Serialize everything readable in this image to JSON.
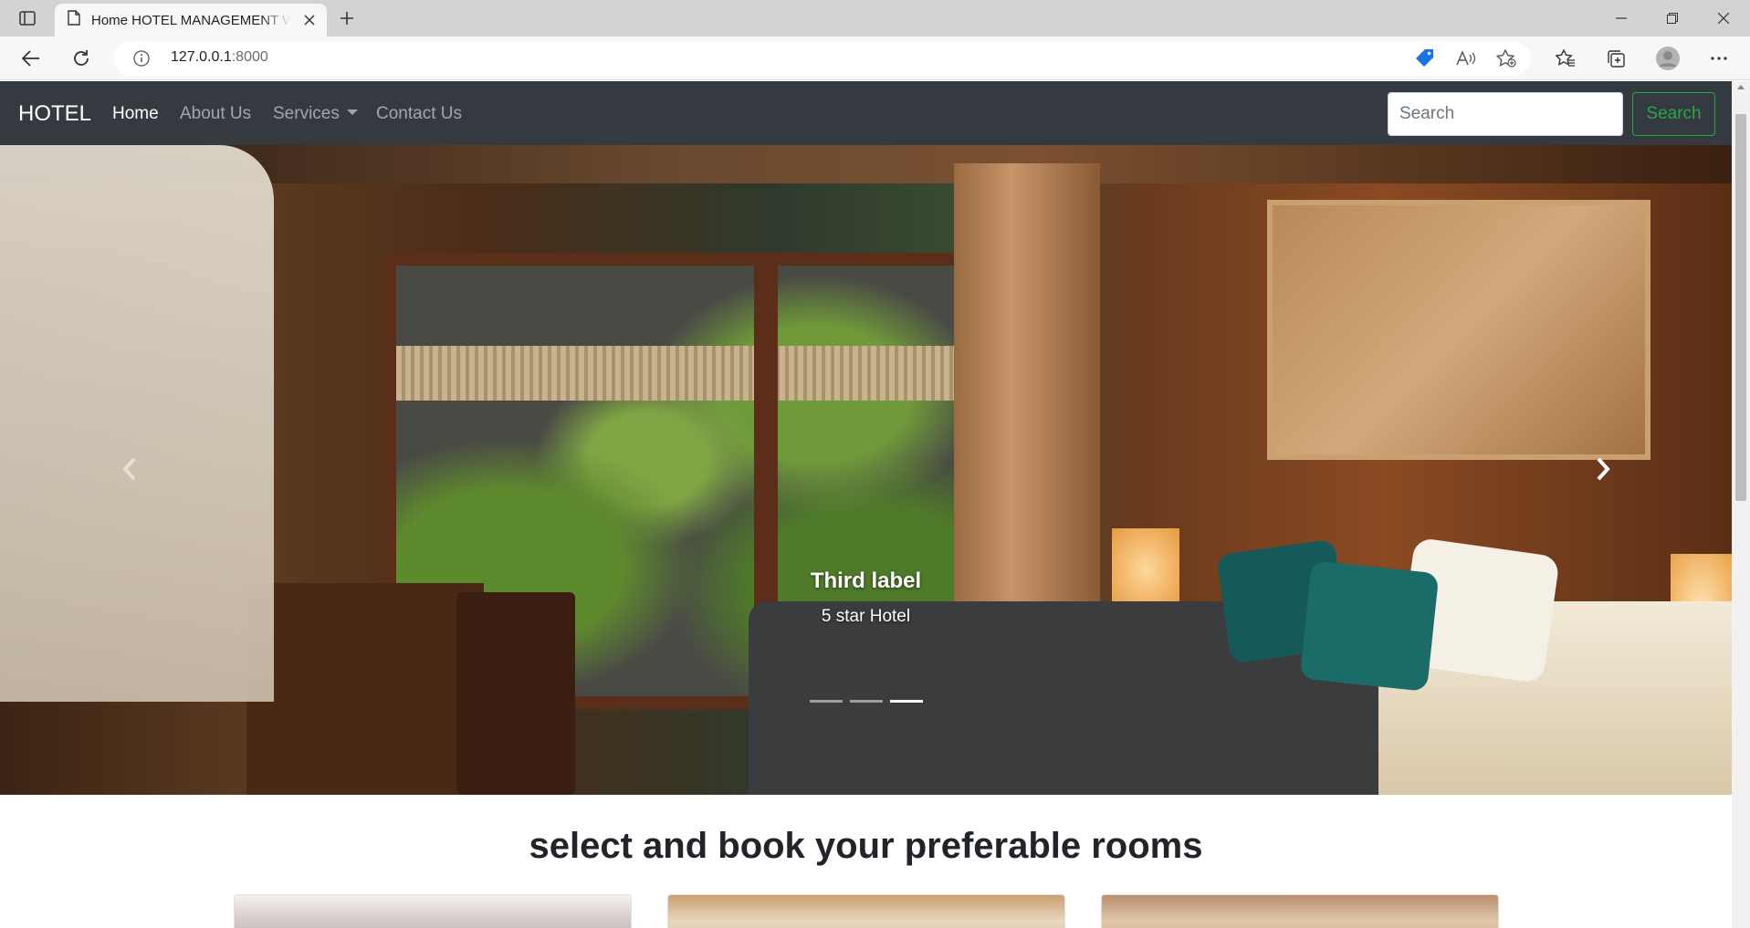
{
  "browser": {
    "tab_title": "Home HOTEL MANAGEMENT WE",
    "url_host": "127.0.0.1",
    "url_port": ":8000",
    "icons": [
      "tab-actions-icon",
      "page-icon",
      "close-icon",
      "plus-icon",
      "minimize-icon",
      "restore-icon",
      "window-close-icon",
      "back-arrow-icon",
      "refresh-icon",
      "info-icon",
      "tag-icon",
      "read-aloud-icon",
      "add-favorite-icon",
      "favorites-icon",
      "collections-icon",
      "profile-icon",
      "more-icon"
    ],
    "colors": {
      "tab_bar": "#d3d3d3",
      "toolbar": "#f7f7f7",
      "tag_icon": "#1a73e8"
    }
  },
  "navbar": {
    "brand": "HOTEL",
    "links": [
      "Home",
      "About Us",
      "Services",
      "Contact Us"
    ],
    "active_link": "Home",
    "search_placeholder": "Search",
    "search_button": "Search",
    "colors": {
      "background": "#343a40",
      "search_button": "#28a745"
    }
  },
  "carousel": {
    "caption_title": "Third label",
    "caption_text": "5 star Hotel",
    "slide_count": 3,
    "active_slide": 3,
    "icons": [
      "chevron-left-icon",
      "chevron-right-icon"
    ]
  },
  "rooms": {
    "title": "select and book your preferable rooms",
    "cards_visible": 3
  }
}
